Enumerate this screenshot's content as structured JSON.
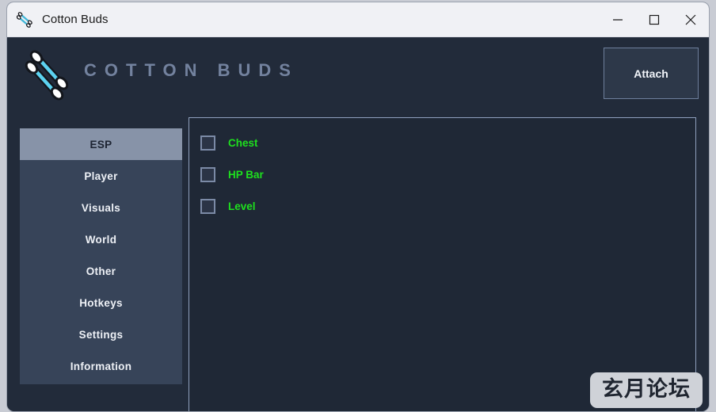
{
  "window": {
    "title": "Cotton Buds",
    "title_icon": "cotton-swabs-icon",
    "controls": {
      "minimize": "minimize-icon",
      "maximize": "maximize-icon",
      "close": "close-icon"
    }
  },
  "header": {
    "logo_icon": "cotton-swabs-logo-icon",
    "brand_title": "COTTON BUDS",
    "attach_label": "Attach"
  },
  "sidebar": {
    "items": [
      {
        "label": "ESP",
        "selected": true
      },
      {
        "label": "Player",
        "selected": false
      },
      {
        "label": "Visuals",
        "selected": false
      },
      {
        "label": "World",
        "selected": false
      },
      {
        "label": "Other",
        "selected": false
      },
      {
        "label": "Hotkeys",
        "selected": false
      },
      {
        "label": "Settings",
        "selected": false
      },
      {
        "label": "Information",
        "selected": false
      }
    ]
  },
  "content": {
    "options": [
      {
        "label": "Chest",
        "checked": false
      },
      {
        "label": "HP Bar",
        "checked": false
      },
      {
        "label": "Level",
        "checked": false
      }
    ]
  },
  "watermark": {
    "text": "玄月论坛"
  },
  "colors": {
    "window_background": "#222b3a",
    "titlebar_background": "#f0f1f5",
    "sidebar_background": "#374459",
    "sidebar_selected": "#8793a8",
    "panel_background": "#1f2836",
    "panel_border": "#8fa0bd",
    "brand_text": "#73829e",
    "option_label": "#1ee01e",
    "accent_cyan": "#5cd2f0"
  }
}
